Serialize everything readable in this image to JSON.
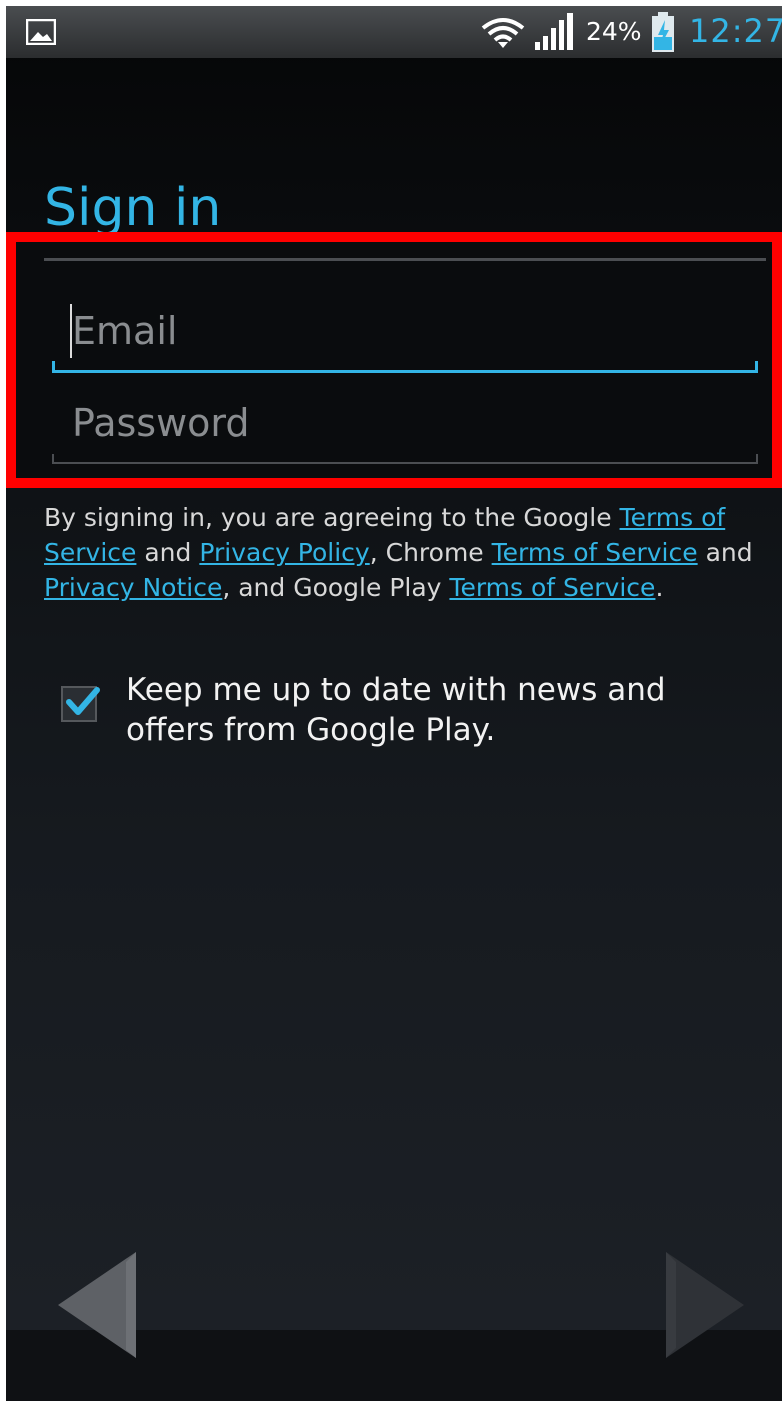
{
  "status_bar": {
    "battery_percent": "24%",
    "time": "12:27",
    "icons": [
      "gallery-icon",
      "wifi-icon",
      "signal-icon",
      "battery-charging-icon"
    ]
  },
  "signin": {
    "title": "Sign in",
    "email_placeholder": "Email",
    "email_value": "",
    "password_placeholder": "Password",
    "password_value": ""
  },
  "terms": {
    "t1": "By signing in, you are agreeing to the Google ",
    "link_google_tos": "Terms of Service",
    "t2": " and ",
    "link_privacy_policy": "Privacy Policy",
    "t3": ", Chrome ",
    "link_chrome_tos": "Terms of Service",
    "t4": " and ",
    "link_privacy_notice": "Privacy Notice",
    "t5": ", and Google Play ",
    "link_play_tos": "Terms of Service",
    "t6": "."
  },
  "newsletter": {
    "label": "Keep me up to date with news and offers from Google Play.",
    "checked": true
  },
  "navigation": {
    "icons": [
      "back-arrow-icon",
      "next-arrow-icon"
    ]
  },
  "colors": {
    "accent": "#33b5e5",
    "highlight_border": "#ff0000"
  }
}
